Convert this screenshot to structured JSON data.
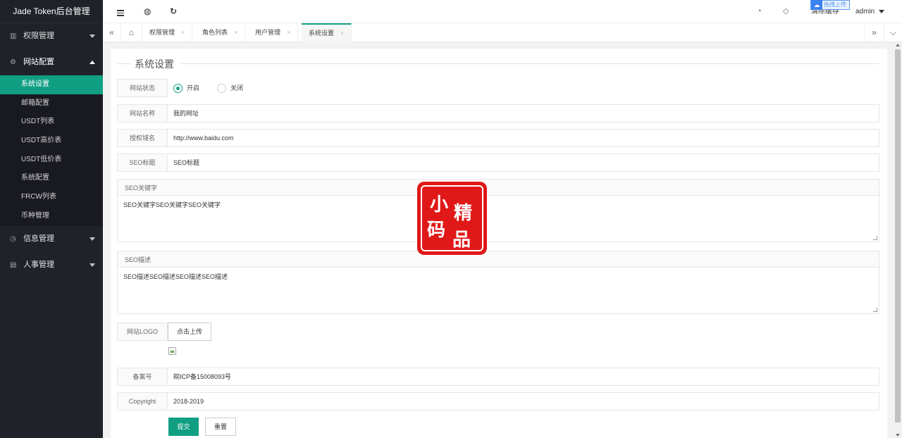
{
  "app": {
    "title": "Jade Token后台管理"
  },
  "sidebar": {
    "groups": [
      {
        "label": "权限管理",
        "icon": "permission-icon"
      },
      {
        "label": "网站配置",
        "icon": "settings-icon"
      },
      {
        "label": "信息管理",
        "icon": "info-icon"
      },
      {
        "label": "人事管理",
        "icon": "personnel-icon"
      }
    ],
    "sub_items": [
      "系统设置",
      "邮箱配置",
      "USDT列表",
      "USDT高价表",
      "USDT低价表",
      "系统配置",
      "FRCW列表",
      "币种管理"
    ]
  },
  "header": {
    "icons": [
      "menu-toggle-icon",
      "globe-icon",
      "refresh-icon",
      "theme-icon",
      "tag-icon"
    ],
    "upload_tag": "拖拽上传",
    "clear_cache": "清除缓存",
    "user": "admin"
  },
  "tabs": {
    "items": [
      "权限管理",
      "角色列表",
      "用户管理",
      "系统设置"
    ],
    "active": "系统设置"
  },
  "form": {
    "legend": "系统设置",
    "site_status": {
      "label": "网站状态",
      "on": "开启",
      "off": "关闭",
      "selected": "开启"
    },
    "site_name": {
      "label": "网站名称",
      "value": "我的网址"
    },
    "auth_domain": {
      "label": "授权域名",
      "value": "http://www.baidu.com"
    },
    "seo_title": {
      "label": "SEO标题",
      "value": "SEO标题"
    },
    "seo_keywords": {
      "label": "SEO关键字",
      "value": "SEO关键字SEO关键字SEO关键字"
    },
    "seo_desc": {
      "label": "SEO描述",
      "value": "SEO描述SEO描述SEO描述SEO描述"
    },
    "logo": {
      "label": "网站LOGO",
      "button": "点击上传"
    },
    "icp": {
      "label": "备案号",
      "value": "皖ICP备15008093号"
    },
    "copyright": {
      "label": "Copyright",
      "value": "2018-2019"
    },
    "submit": "提交",
    "reset": "重置"
  },
  "watermark": {
    "chars": [
      "小",
      "精",
      "码",
      "品"
    ]
  }
}
